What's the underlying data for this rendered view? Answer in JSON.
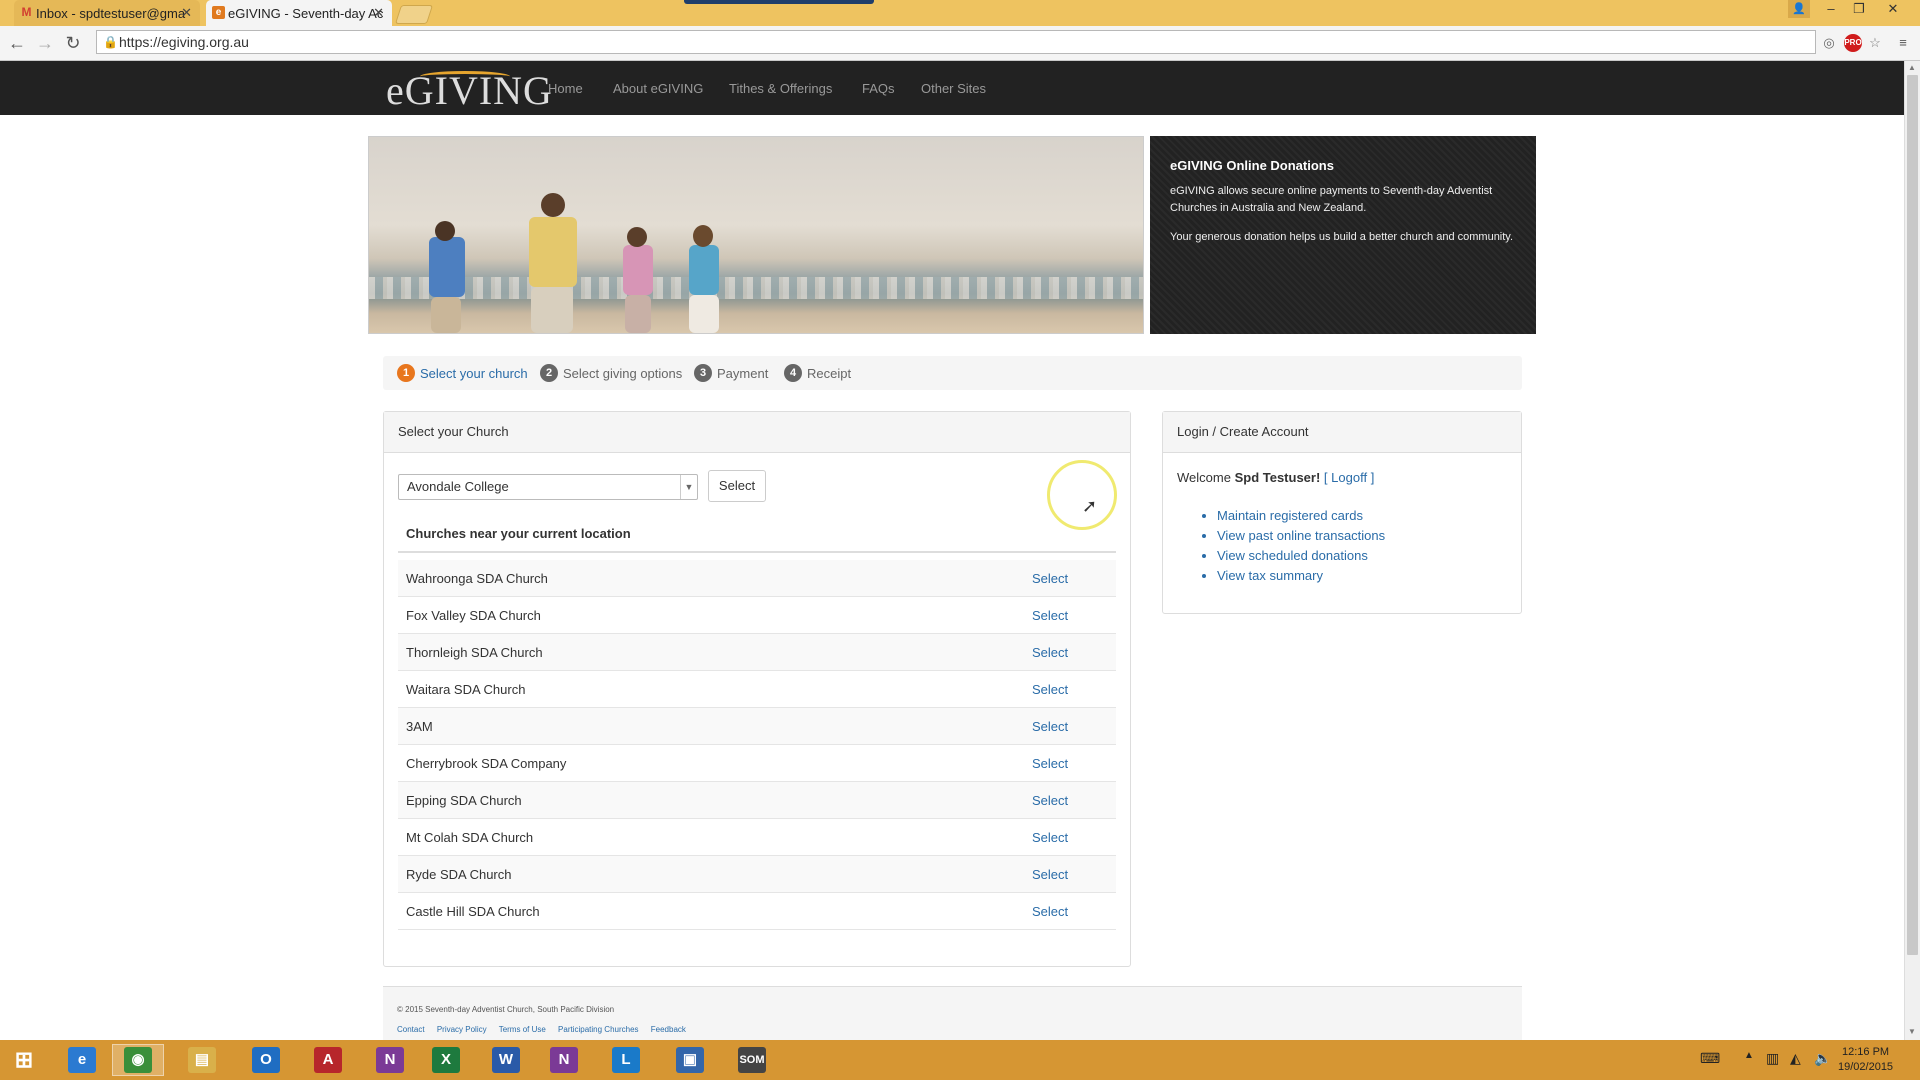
{
  "browser": {
    "tabs": [
      {
        "title": "Inbox - spdtestuser@gma",
        "icon": "gmail-icon"
      },
      {
        "title": "eGIVING - Seventh-day Ac",
        "icon": "egiving-icon"
      }
    ],
    "url": "https://egiving.org.au"
  },
  "site": {
    "logo": "eGIVING",
    "nav": [
      "Home",
      "About eGIVING",
      "Tithes & Offerings",
      "FAQs",
      "Other Sites"
    ]
  },
  "info": {
    "title": "eGIVING Online Donations",
    "p1": "eGIVING allows secure online payments to Seventh-day Adventist Churches in Australia and New Zealand.",
    "p2": "Your generous donation helps us build a better church and community."
  },
  "steps": [
    {
      "num": "1",
      "label": "Select your church"
    },
    {
      "num": "2",
      "label": "Select giving options"
    },
    {
      "num": "3",
      "label": "Payment"
    },
    {
      "num": "4",
      "label": "Receipt"
    }
  ],
  "church_panel": {
    "title": "Select your Church",
    "selected": "Avondale College",
    "select_button": "Select",
    "nearby_heading": "Churches near your current location",
    "select_link": "Select",
    "churches": [
      "Wahroonga SDA Church",
      "Fox Valley SDA Church",
      "Thornleigh SDA Church",
      "Waitara SDA Church",
      "3AM",
      "Cherrybrook SDA Company",
      "Epping SDA Church",
      "Mt Colah SDA Church",
      "Ryde SDA Church",
      "Castle Hill SDA Church"
    ]
  },
  "account_panel": {
    "title": "Login / Create Account",
    "welcome": "Welcome",
    "user": "Spd Testuser!",
    "logoff": "Logoff",
    "links": [
      "Maintain registered cards",
      "View past online transactions",
      "View scheduled donations",
      "View tax summary"
    ]
  },
  "footer": {
    "copyright": "© 2015 Seventh-day Adventist Church, South Pacific Division",
    "links": [
      "Contact",
      "Privacy Policy",
      "Terms of Use",
      "Participating Churches",
      "Feedback"
    ]
  },
  "taskbar": {
    "time": "12:16 PM",
    "date": "19/02/2015",
    "apps": [
      {
        "icon": "internet-explorer-icon",
        "glyph": "e",
        "color": "#2b7ad1"
      },
      {
        "icon": "chrome-icon",
        "glyph": "◉",
        "color": "#3a8f3a"
      },
      {
        "icon": "file-explorer-icon",
        "glyph": "▤",
        "color": "#d9b04a"
      },
      {
        "icon": "outlook-icon",
        "glyph": "O",
        "color": "#1f6dc2"
      },
      {
        "icon": "access-icon",
        "glyph": "A",
        "color": "#b7262b"
      },
      {
        "icon": "onenote-icon",
        "glyph": "N",
        "color": "#7b3a96"
      },
      {
        "icon": "excel-icon",
        "glyph": "X",
        "color": "#1e7a3e"
      },
      {
        "icon": "word-icon",
        "glyph": "W",
        "color": "#2a5aa8"
      },
      {
        "icon": "onenote-alt-icon",
        "glyph": "N",
        "color": "#7b3a96"
      },
      {
        "icon": "lync-icon",
        "glyph": "L",
        "color": "#1a7ac9"
      },
      {
        "icon": "remote-desktop-icon",
        "glyph": "▣",
        "color": "#3366aa"
      },
      {
        "icon": "som-icon",
        "glyph": "SOM",
        "color": "#444"
      }
    ]
  }
}
